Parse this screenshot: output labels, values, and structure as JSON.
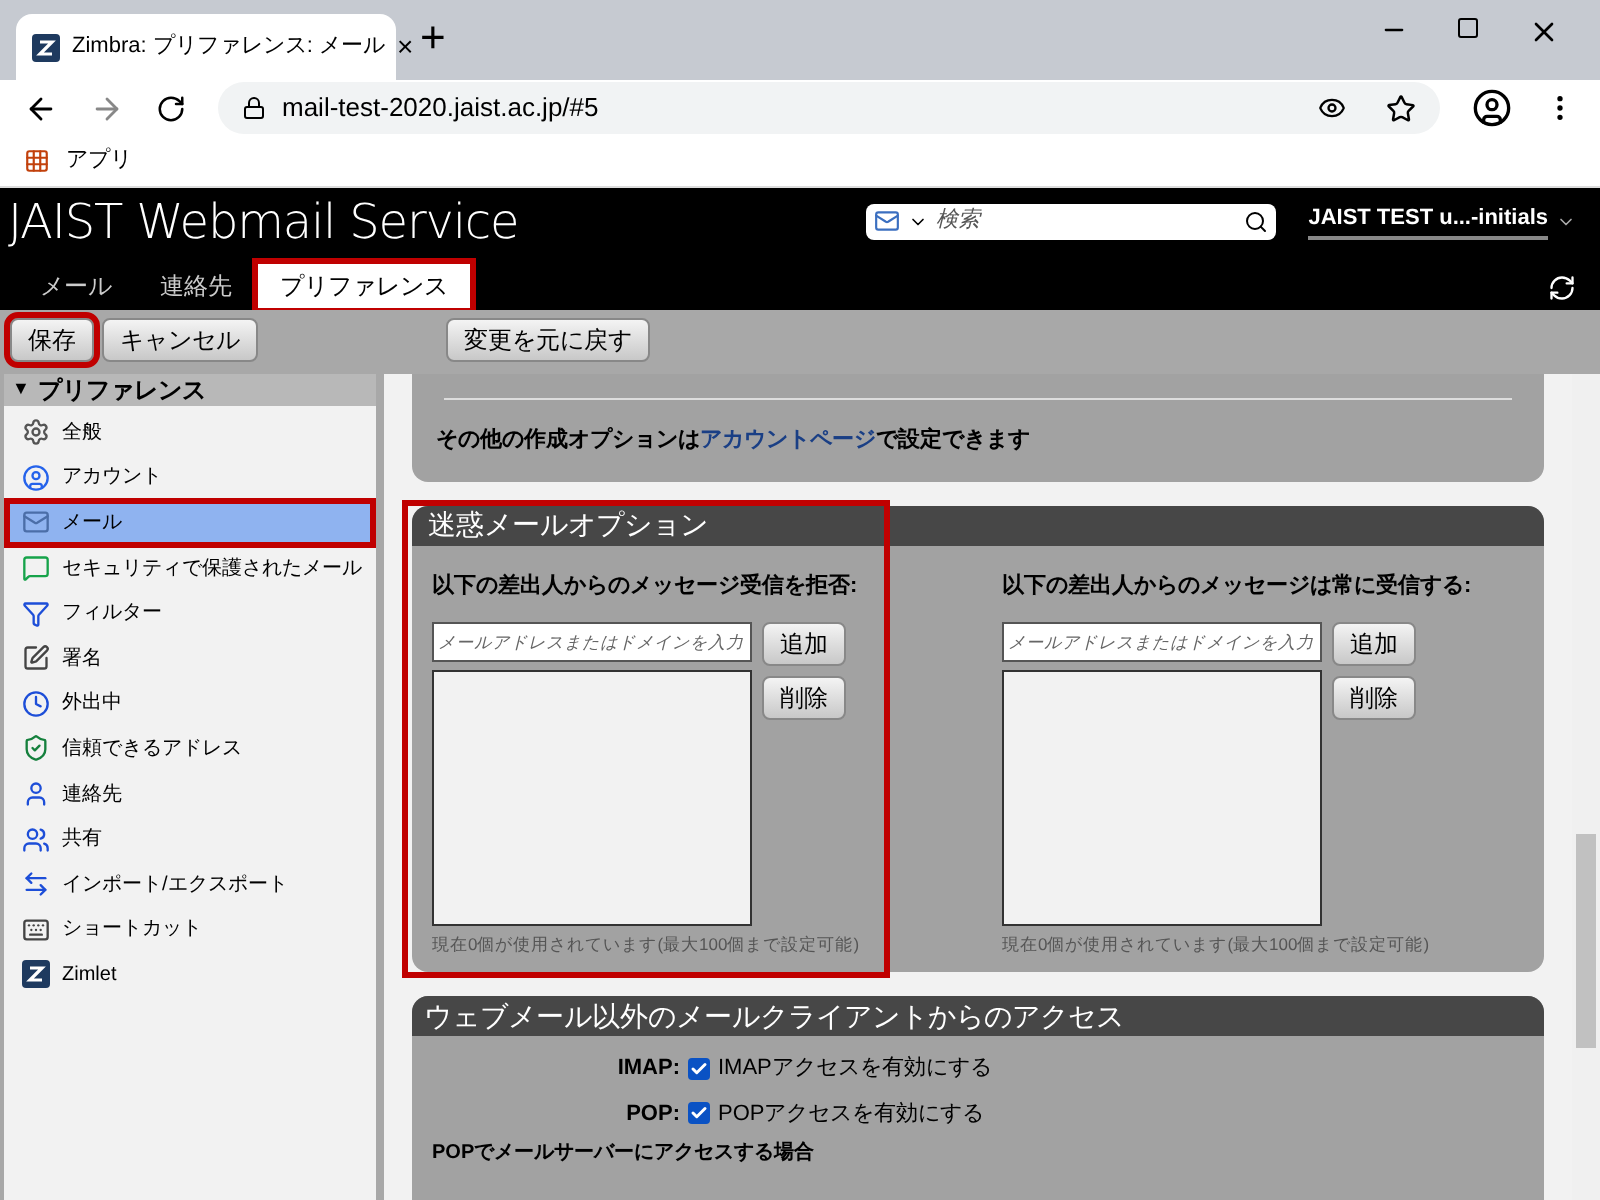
{
  "browser": {
    "tab_title": "Zimbra: プリファレンス: メール",
    "tab_close": "×",
    "new_tab": "+",
    "url": "mail-test-2020.jaist.ac.jp/#5",
    "bookmarks": [
      "アプリ"
    ]
  },
  "header": {
    "logo": "JAIST Webmail Service",
    "search": {
      "placeholder": "検索"
    },
    "user": "JAIST TEST u...-initials"
  },
  "app_tabs": [
    {
      "label": "メール",
      "selected": false,
      "highlighted": false
    },
    {
      "label": "連絡先",
      "selected": false,
      "highlighted": false
    },
    {
      "label": "プリファレンス",
      "selected": true,
      "highlighted": true
    }
  ],
  "toolbar": [
    {
      "label": "保存",
      "highlighted": true
    },
    {
      "label": "キャンセル",
      "highlighted": false
    },
    {
      "label": "変更を元に戻す",
      "highlighted": false
    }
  ],
  "sidebar": {
    "toggle": "▼",
    "title": "プリファレンス",
    "expanded": true,
    "items": [
      {
        "label": "全般",
        "selected": false,
        "highlighted": false
      },
      {
        "label": "アカウント",
        "selected": false,
        "highlighted": false
      },
      {
        "label": "メール",
        "selected": true,
        "highlighted": true
      },
      {
        "label": "セキュリティで保護されたメール",
        "selected": false,
        "highlighted": false
      },
      {
        "label": "フィルター",
        "selected": false,
        "highlighted": false
      },
      {
        "label": "署名",
        "selected": false,
        "highlighted": false
      },
      {
        "label": "外出中",
        "selected": false,
        "highlighted": false
      },
      {
        "label": "信頼できるアドレス",
        "selected": false,
        "highlighted": false
      },
      {
        "label": "連絡先",
        "selected": false,
        "highlighted": false
      },
      {
        "label": "共有",
        "selected": false,
        "highlighted": false
      },
      {
        "label": "インポート/エクスポート",
        "selected": false,
        "highlighted": false
      },
      {
        "label": "ショートカット",
        "selected": false,
        "highlighted": false
      },
      {
        "label": "Zimlet",
        "selected": false,
        "highlighted": false
      }
    ]
  },
  "compose_note": {
    "before": "その他の作成オプションは",
    "link": "アカウントページ",
    "after": "で設定できます"
  },
  "junk": {
    "title": "迷惑メールオプション",
    "columns": [
      {
        "label": "以下の差出人からのメッセージ受信を拒否:",
        "placeholder": "メールアドレスまたはドメインを入力",
        "add": "追加",
        "remove": "削除",
        "note": "現在0個が使用されています(最大100個まで設定可能)",
        "highlighted": true
      },
      {
        "label": "以下の差出人からのメッセージは常に受信する:",
        "placeholder": "メールアドレスまたはドメインを入力",
        "add": "追加",
        "remove": "削除",
        "note": "現在0個が使用されています(最大100個まで設定可能)",
        "highlighted": false
      }
    ]
  },
  "access": {
    "title": "ウェブメール以外のメールクライアントからのアクセス",
    "rows": [
      {
        "label": "IMAP:",
        "option": "IMAPアクセスを有効にする",
        "checked": true
      },
      {
        "label": "POP:",
        "option": "POPアクセスを有効にする",
        "checked": true
      }
    ],
    "subheading": "POPでメールサーバーにアクセスする場合"
  }
}
